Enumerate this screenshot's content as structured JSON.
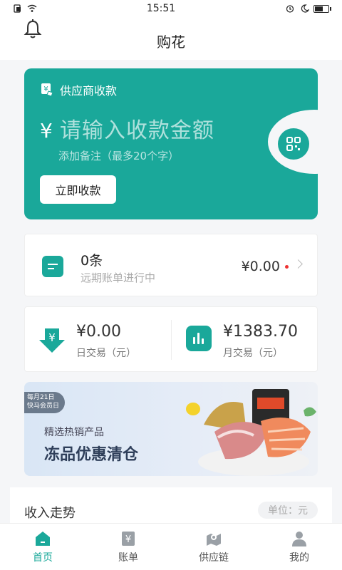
{
  "status": {
    "time": "15:51"
  },
  "header": {
    "title": "购花"
  },
  "pay_card": {
    "heading": "供应商收款",
    "currency": "¥",
    "amount_placeholder": "请输入收款金额",
    "note_placeholder": "添加备注（最多20个字）",
    "button": "立即收款"
  },
  "bill": {
    "count": "0条",
    "desc": "远期账单进行中",
    "amount": "¥0.00"
  },
  "stats": {
    "day_value": "¥0.00",
    "day_label": "日交易（元）",
    "month_value": "¥1383.70",
    "month_label": "月交易（元）"
  },
  "banner": {
    "tag_line1": "每月21日",
    "tag_line2": "快马会员日",
    "subtitle": "精选热销产品",
    "title": "冻品优惠清仓"
  },
  "income": {
    "title": "收入走势",
    "unit": "单位：元"
  },
  "tabs": [
    {
      "label": "首页"
    },
    {
      "label": "账单"
    },
    {
      "label": "供应链"
    },
    {
      "label": "我的"
    }
  ],
  "colors": {
    "accent": "#1aa89a",
    "background": "#f5f6f8"
  }
}
